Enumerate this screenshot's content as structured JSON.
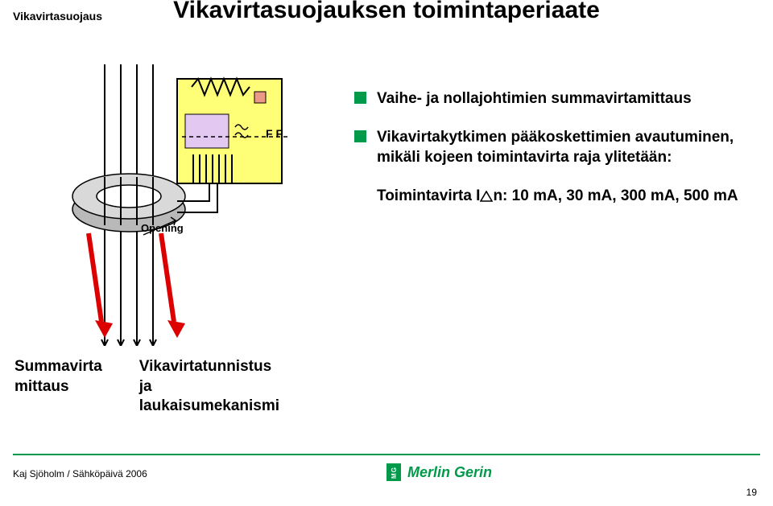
{
  "header": {
    "topic": "Vikavirtasuojaus",
    "title": "Vikavirtasuojauksen toimintaperiaate"
  },
  "bullets": {
    "b1": "Vaihe- ja nollajohtimien summavirtamittaus",
    "b2": "Vikavirtakytkimen pääkoskettimien avautuminen, mikäli kojeen toimintavirta raja ylitetään:",
    "last_prefix": "Toimintavirta I",
    "last_suffix": "n: 10 mA, 30 mA, 300 mA, 500 mA"
  },
  "diagram": {
    "opening_label": "Opening",
    "f_left": "F",
    "f_right": "F"
  },
  "lower": {
    "col1_l1": "Summavirta",
    "col1_l2": "mittaus",
    "col2_l1": "Vikavirtatunnistus",
    "col2_l2": "ja",
    "col2_l3": "laukaisumekanismi"
  },
  "footer": {
    "author": "Kaj Sjöholm / Sähköpäivä 2006",
    "brand": "Merlin Gerin",
    "page": "19"
  }
}
